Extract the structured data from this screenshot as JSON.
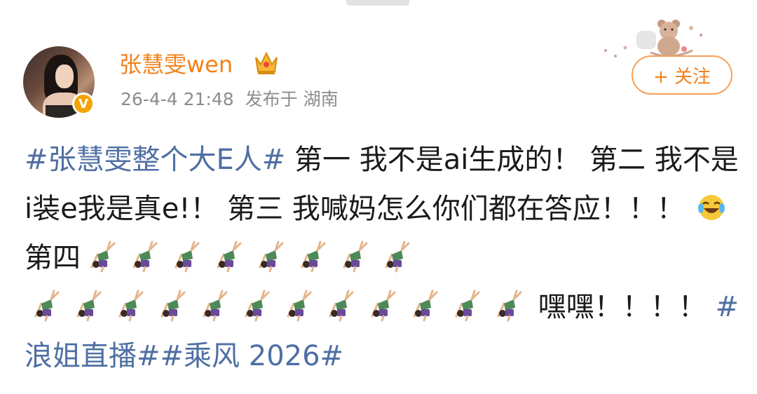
{
  "user": {
    "name": "张慧雯wen",
    "post_time": "26-4-4 21:48",
    "post_location": "发布于 湖南",
    "verified_icon": "verified-v-icon",
    "crown_icon": "crown-icon",
    "avatar_icon": "user-avatar"
  },
  "follow": {
    "label": "+ 关注"
  },
  "post": {
    "hashtag1": "#张慧雯整个大E人#",
    "text1": "第一 我不是ai生成的！ 第二 我不是i装e我是真e!！ 第三 我喊妈怎么你们都在答应！！！",
    "emoji_laugh": "face-with-tears-of-joy-icon",
    "text2": "第四",
    "dancer_icon": "cartwheel-person-icon",
    "dancer_count_row1": 8,
    "dancer_count_row2": 12,
    "text3": "嘿嘿！！！！",
    "hashtag2": "#浪姐直播#",
    "hashtag3": "#乘风 2026#"
  },
  "colors": {
    "username": "#f4801a",
    "hashtag": "#4f6fa3",
    "meta": "#8c8c8c",
    "follow_border": "#f6a05a",
    "verified": "#f5a300"
  }
}
